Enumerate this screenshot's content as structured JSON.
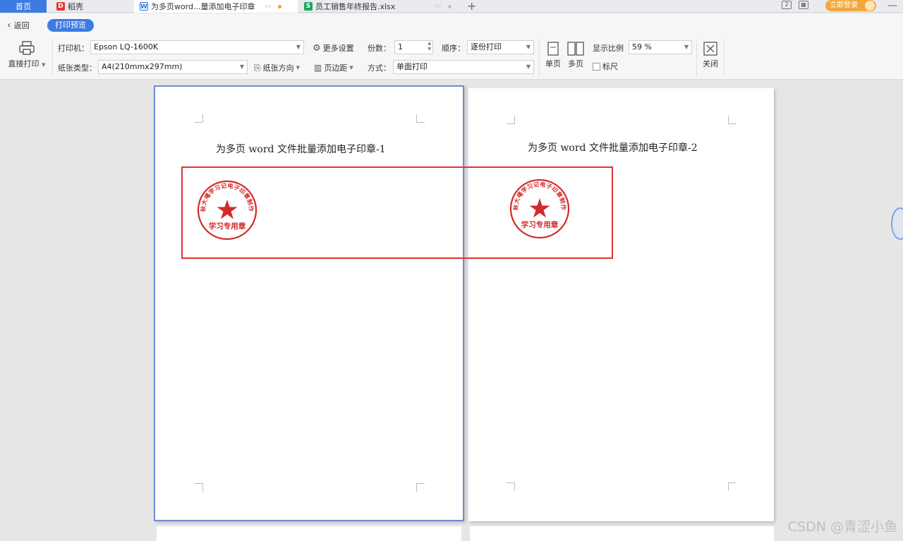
{
  "tabs": {
    "home": "首页",
    "docer": "稻壳",
    "doc": "为多页word...量添加电子印章",
    "xlsx": "员工销售年终报告.xlsx",
    "doc_icon": "W",
    "xlsx_icon": "S",
    "docer_icon": "D"
  },
  "header": {
    "login_button": "立即登录",
    "badge": "2",
    "minimize": "—"
  },
  "nav": {
    "back": "返回",
    "preview": "打印预览"
  },
  "toolbar": {
    "direct_print": "直接打印",
    "printer_label": "打印机：",
    "printer_value": "Epson LQ-1600K",
    "paper_label": "纸张类型：",
    "paper_value": "A4(210mmx297mm)",
    "more_settings": "更多设置",
    "orientation": "纸张方向",
    "margins": "页边距",
    "copies_label": "份数：",
    "copies_value": "1",
    "order_label": "顺序：",
    "order_value": "逐份打印",
    "mode_label": "方式：",
    "mode_value": "单面打印",
    "single_page": "单页",
    "multi_page": "多页",
    "zoom_label": "显示比例",
    "zoom_value": "59 %",
    "ruler": "标尺",
    "close": "关闭"
  },
  "pages": [
    {
      "title": "为多页 word 文件批量添加电子印章-1"
    },
    {
      "title": "为多页 word 文件批量添加电子印章-2"
    }
  ],
  "stamp": {
    "ring_text": "秋大噶学习记电子印章制作",
    "bottom_text": "学习专用章",
    "color": "#d42a2a"
  },
  "watermark": "CSDN @青涩小鱼",
  "colors": {
    "accent": "#3d7be0",
    "highlight_box": "#e03333",
    "page_selection": "#6b8fd6"
  }
}
